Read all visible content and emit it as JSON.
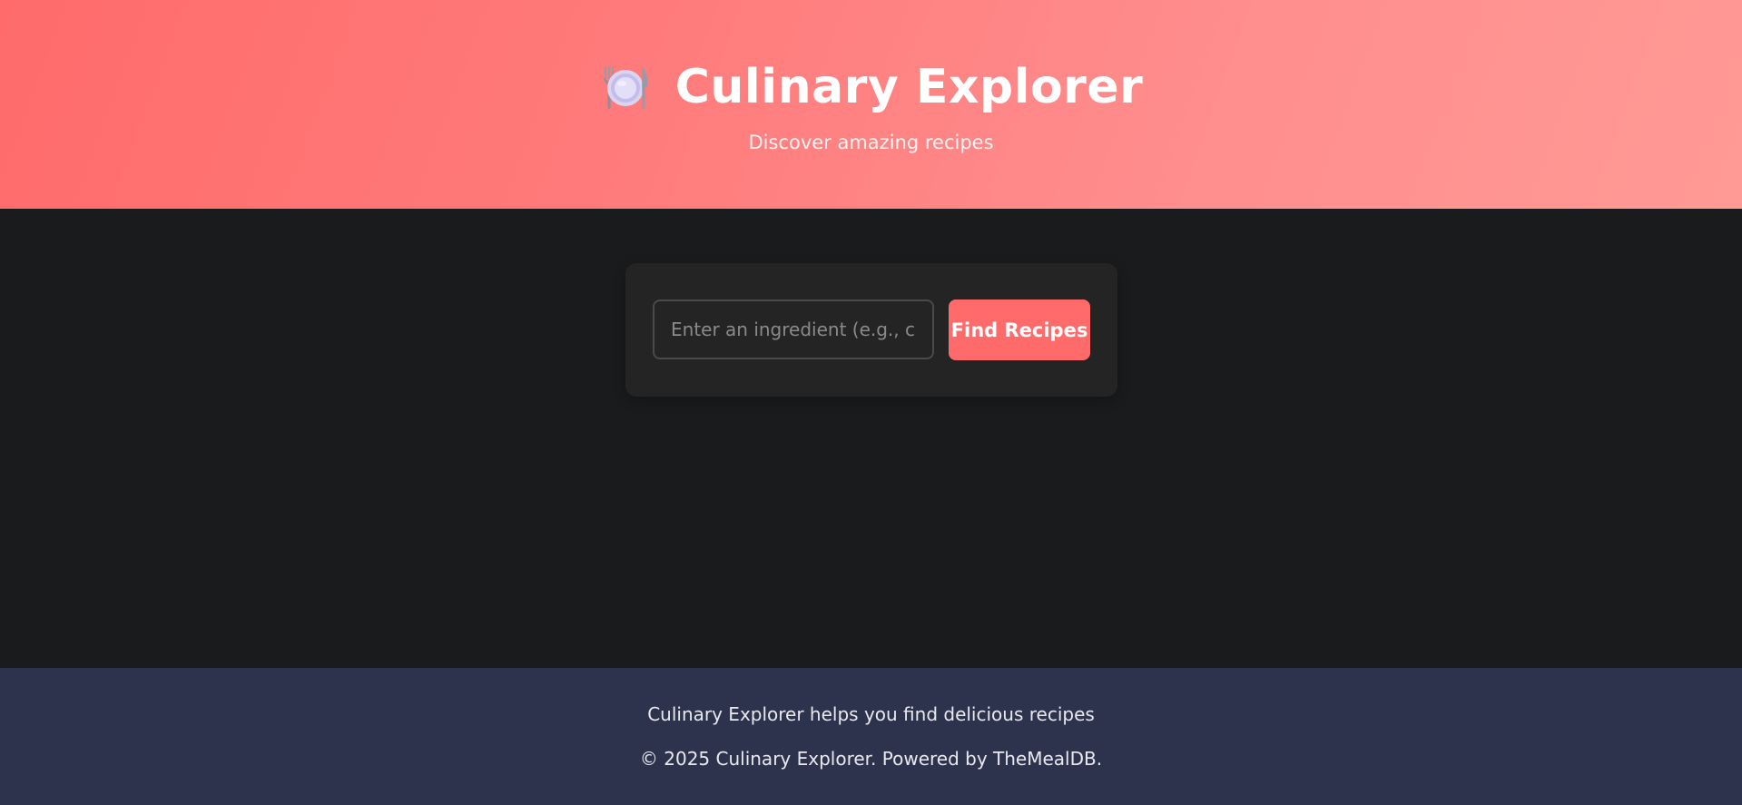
{
  "header": {
    "icon": "plate-with-cutlery-icon",
    "title": "Culinary Explorer",
    "subtitle": "Discover amazing recipes"
  },
  "search": {
    "placeholder": "Enter an ingredient (e.g., chicken)",
    "value": "",
    "button_label": "Find Recipes"
  },
  "footer": {
    "tagline": "Culinary Explorer helps you find delicious recipes",
    "copyright": "© 2025 Culinary Explorer. Powered by TheMealDB."
  },
  "colors": {
    "accent": "#ff6b6b",
    "background": "#1a1b1d",
    "card": "#242424",
    "footer": "#2e334d"
  }
}
